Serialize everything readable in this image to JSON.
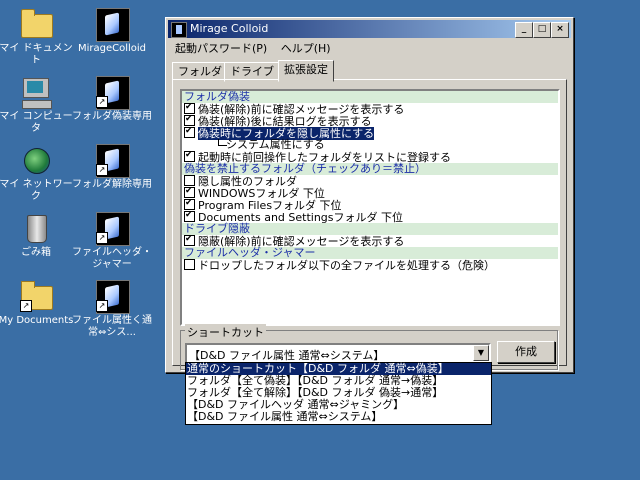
{
  "desktop": {
    "background": "#3a6ea5",
    "icons": [
      {
        "name": "my-documents",
        "label": "マイ ドキュメント"
      },
      {
        "name": "mirage-colloid",
        "label": "MirageColloid"
      },
      {
        "name": "my-computer",
        "label": "マイ コンピュータ"
      },
      {
        "name": "folder-disguise",
        "label": "フォルダ偽装専用"
      },
      {
        "name": "my-network",
        "label": "マイ ネットワーク"
      },
      {
        "name": "folder-undisguise",
        "label": "フォルダ解除専用"
      },
      {
        "name": "recycle-bin",
        "label": "ごみ箱"
      },
      {
        "name": "file-header-jammer",
        "label": "ファイルヘッダ・ジャマー"
      },
      {
        "name": "my-documents-folder",
        "label": "My Documents"
      },
      {
        "name": "file-attribute",
        "label": "ファイル属性く通常⇔シス..."
      }
    ]
  },
  "window": {
    "title": "Mirage Colloid",
    "controls": {
      "minimize": "_",
      "maximize": "□",
      "close": "×"
    },
    "menu": [
      "起動パスワード(P)",
      "ヘルプ(H)"
    ],
    "tabs": [
      "フォルダ",
      "ドライブ",
      "拡張設定"
    ],
    "active_tab": "拡張設定",
    "settings_list": [
      {
        "type": "section",
        "text": "フォルダ偽装"
      },
      {
        "type": "item",
        "checked": true,
        "text": "偽装(解除)前に確認メッセージを表示する"
      },
      {
        "type": "item",
        "checked": true,
        "text": "偽装(解除)後に結果ログを表示する"
      },
      {
        "type": "item",
        "checked": true,
        "selected": true,
        "text": "偽装時にフォルダを隠し属性にする"
      },
      {
        "type": "subitem",
        "checked": true,
        "text": "システム属性にする"
      },
      {
        "type": "item",
        "checked": true,
        "text": "起動時に前回操作したフォルダをリストに登録する"
      },
      {
        "type": "section",
        "text": "偽装を禁止するフォルダ（チェックあり＝禁止）"
      },
      {
        "type": "item",
        "checked": false,
        "text": "隠し属性のフォルダ"
      },
      {
        "type": "item",
        "checked": true,
        "text": "WINDOWSフォルダ 下位"
      },
      {
        "type": "item",
        "checked": true,
        "text": "Program Filesフォルダ 下位"
      },
      {
        "type": "item",
        "checked": true,
        "text": "Documents and Settingsフォルダ 下位"
      },
      {
        "type": "section",
        "text": "ドライブ隠蔽"
      },
      {
        "type": "item",
        "checked": true,
        "text": "隠蔽(解除)前に確認メッセージを表示する"
      },
      {
        "type": "section",
        "text": "ファイルヘッダ・ジャマー"
      },
      {
        "type": "item",
        "checked": false,
        "text": "ドロップしたフォルダ以下の全ファイルを処理する（危険）"
      }
    ],
    "shortcut": {
      "legend": "ショートカット",
      "selected": "【D&D ファイル属性 通常⇔システム】",
      "create_button": "作成",
      "options": [
        "通常のショートカット【D&D フォルダ 通常⇔偽装】",
        "フォルダ【全て偽装】【D&D フォルダ 通常→偽装】",
        "フォルダ【全て解除】【D&D フォルダ 偽装→通常】",
        "【D&D ファイルヘッダ 通常⇔ジャミング】",
        "【D&D ファイル属性 通常⇔システム】"
      ],
      "highlighted_option_index": 0
    }
  }
}
